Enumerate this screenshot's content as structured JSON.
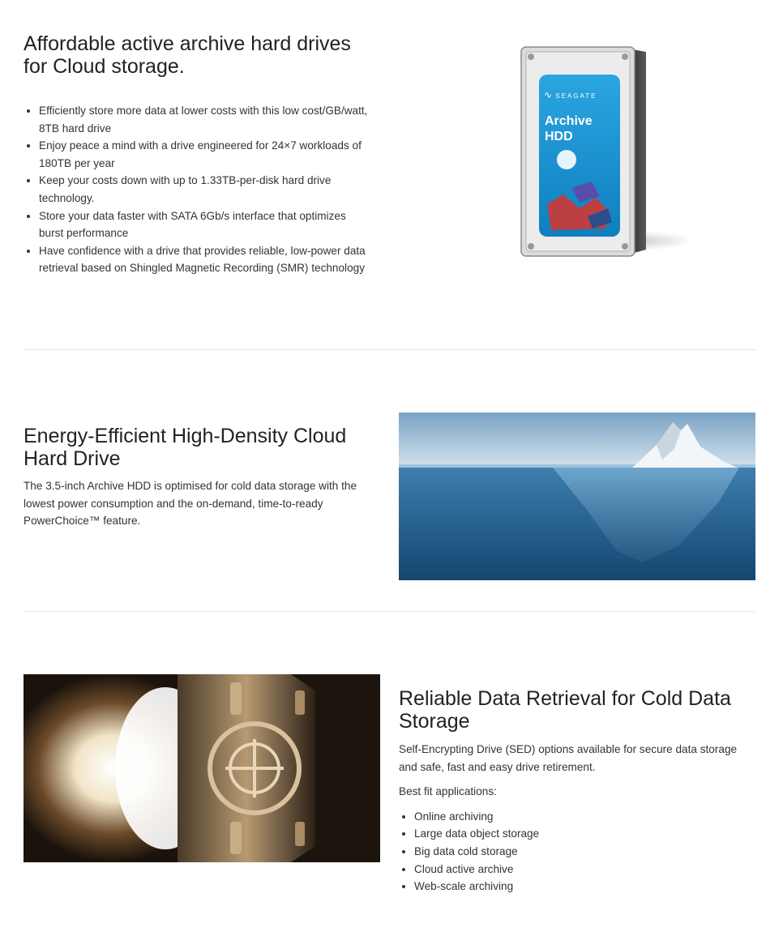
{
  "section1": {
    "title_line1": "Affordable active archive hard drives",
    "title_line2": "for Cloud storage.",
    "bullets": [
      {
        "line1": "Efficiently store more data at lower costs with this low cost/GB/watt,",
        "line2": "8TB hard drive"
      },
      {
        "line1": "Enjoy peace a mind with a drive engineered for 24×7 workloads of",
        "line2": "180TB per year"
      },
      {
        "line1": "Keep your costs down with up to 1.33TB-per-disk hard drive",
        "line2": "technology."
      },
      {
        "line1": "Store your data faster with SATA 6Gb/s interface that optimizes",
        "line2": "burst performance"
      },
      {
        "line1": "Have confidence with a drive that provides reliable, low-power data",
        "line2": "retrieval based on Shingled Magnetic Recording (SMR) technology"
      }
    ],
    "drive_label": {
      "brand": "SEAGATE",
      "line1": "Archive",
      "line2": "HDD"
    }
  },
  "section2": {
    "title_line1": "Energy-Efficient High-Density Cloud",
    "title_line2": "Hard Drive",
    "body_line1": "The 3.5-inch Archive HDD is optimised for cold data storage with the",
    "body_line2": "lowest power consumption and the on-demand, time-to-ready",
    "body_line3": "PowerChoice™ feature."
  },
  "section3": {
    "title_line1": "Reliable Data Retrieval for Cold Data",
    "title_line2": "Storage",
    "body_line1": "Self-Encrypting Drive (SED) options available for secure data storage",
    "body_line2": "and safe, fast and easy drive retirement.",
    "apps_label": "Best fit applications:",
    "apps": [
      "Online archiving",
      "Large data object storage",
      "Big data cold storage",
      "Cloud active archive",
      "Web-scale archiving"
    ]
  },
  "colors": {
    "heading": "#222222",
    "text": "#333333",
    "divider": "#e6e6e6",
    "label_blue": "#1e9ad6"
  }
}
